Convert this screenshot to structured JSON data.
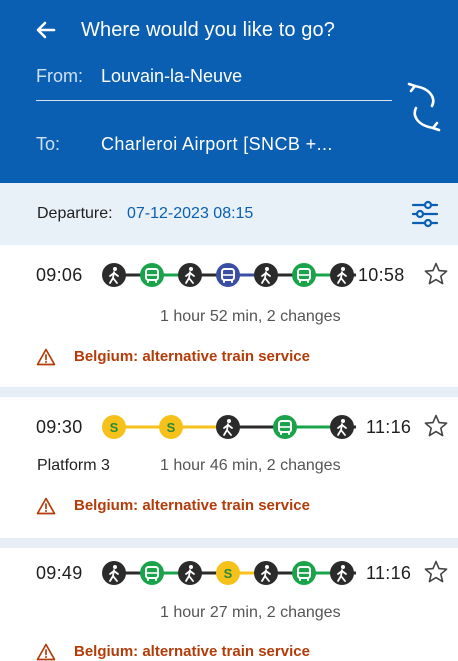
{
  "header": {
    "title": "Where would you like to go?",
    "from_label": "From:",
    "from_value": "Louvain-la-Neuve",
    "to_label": "To:",
    "to_value": "Charleroi Airport [SNCB +..."
  },
  "departure": {
    "label": "Departure:",
    "value": "07-12-2023 08:15"
  },
  "colors": {
    "brand": "#0b5fb3",
    "walk": "#2b2b2b",
    "bus_green": "#1aa34a",
    "bus_blue": "#3a4fa3",
    "train_yellow": "#f6c11a",
    "warning": "#b33c0a"
  },
  "results": [
    {
      "depart": "09:06",
      "arrive": "10:58",
      "platform": "",
      "duration": "1 hour 52 min, 2 changes",
      "alert": "Belgium: alternative train service",
      "legs": [
        "walk",
        "bus-green",
        "walk",
        "bus-blue",
        "walk",
        "bus-green",
        "walk"
      ]
    },
    {
      "depart": "09:30",
      "arrive": "11:16",
      "platform": "Platform 3",
      "duration": "1 hour 46 min, 2 changes",
      "alert": "Belgium: alternative train service",
      "legs": [
        "train",
        "train",
        "walk",
        "bus-green",
        "walk"
      ]
    },
    {
      "depart": "09:49",
      "arrive": "11:16",
      "platform": "",
      "duration": "1 hour 27 min, 2 changes",
      "alert": "Belgium: alternative train service",
      "legs": [
        "walk",
        "bus-green",
        "walk",
        "train",
        "walk",
        "bus-green",
        "walk"
      ]
    }
  ]
}
